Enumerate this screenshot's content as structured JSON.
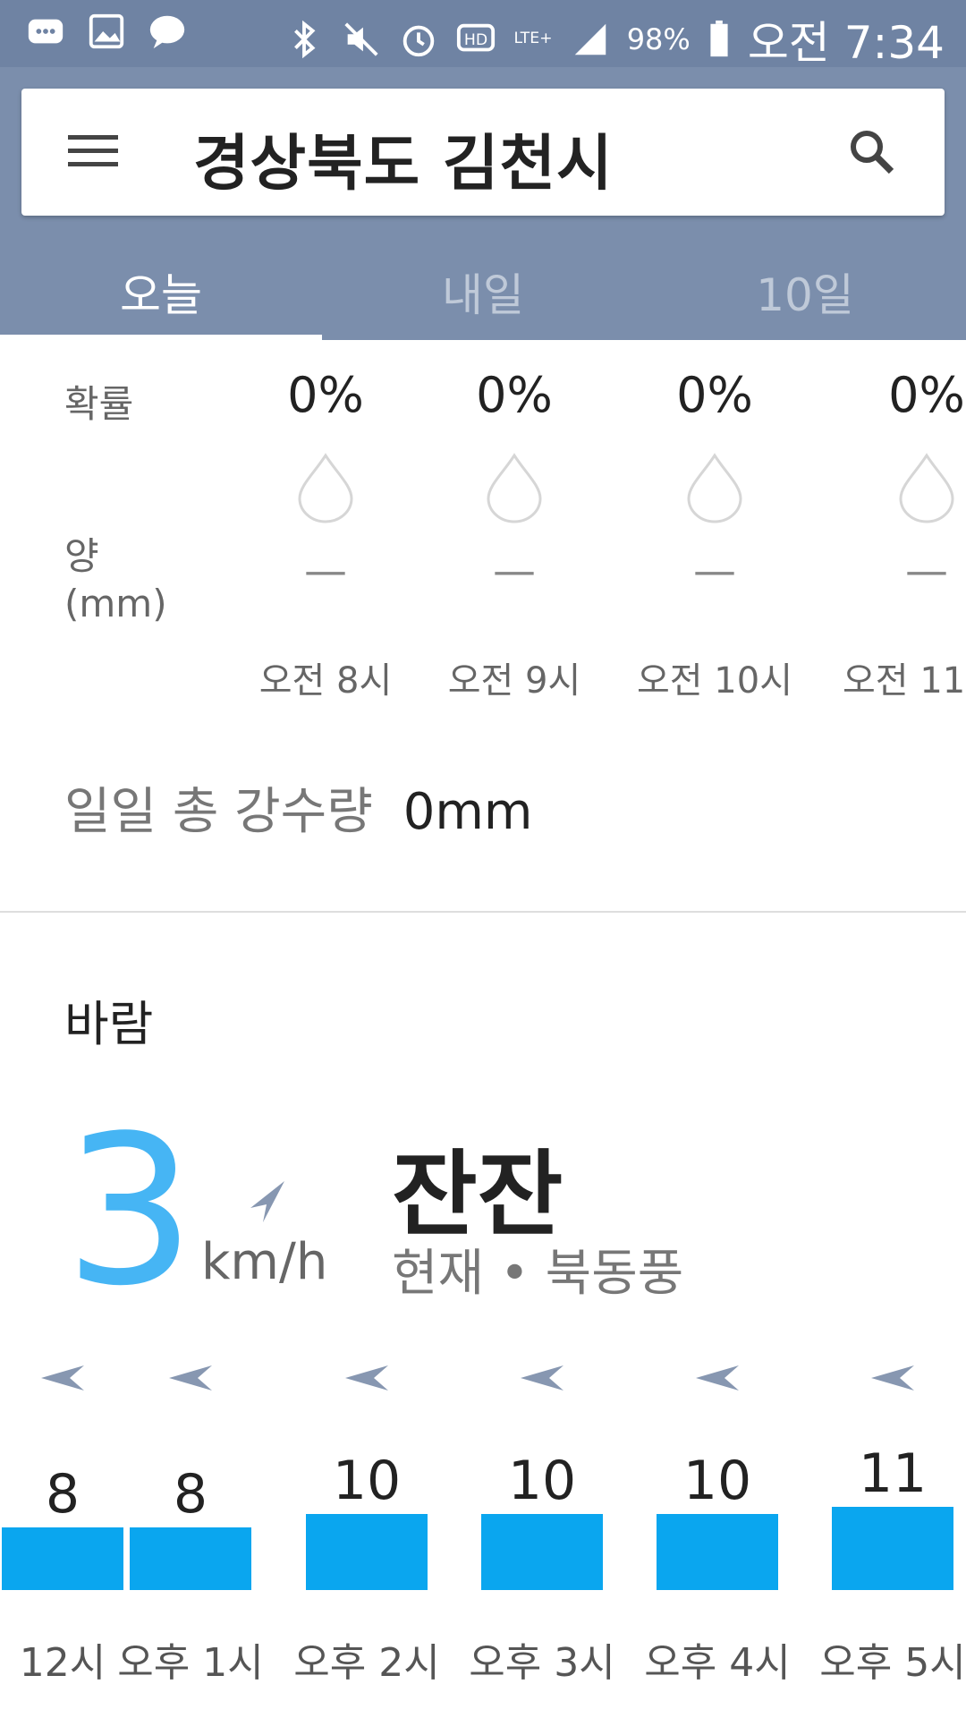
{
  "status_bar": {
    "battery": "98%",
    "time": "오전 7:34",
    "network": "LTE+"
  },
  "header": {
    "location": "경상북도 김천시",
    "tabs": [
      "오늘",
      "내일",
      "10일"
    ],
    "active_tab": 0
  },
  "precipitation": {
    "prob_label": "확률",
    "amount_label_line1": "양",
    "amount_label_line2": "(mm)",
    "hours": [
      {
        "time": "오전 8시",
        "prob": "0%",
        "amount": "—"
      },
      {
        "time": "오전 9시",
        "prob": "0%",
        "amount": "—"
      },
      {
        "time": "오전 10시",
        "prob": "0%",
        "amount": "—"
      },
      {
        "time": "오전 11",
        "prob": "0%",
        "amount": "—"
      }
    ],
    "daily_total_label": "일일 총 강수량",
    "daily_total_value": "0mm"
  },
  "wind": {
    "title": "바람",
    "speed": "3",
    "unit": "km/h",
    "description": "잔잔",
    "current_direction": "현재 • 북동풍",
    "hourly": [
      {
        "label": "12시",
        "value": "8"
      },
      {
        "label": "오후 1시",
        "value": "8"
      },
      {
        "label": "오후 2시",
        "value": "10"
      },
      {
        "label": "오후 3시",
        "value": "10"
      },
      {
        "label": "오후 4시",
        "value": "10"
      },
      {
        "label": "오후 5시",
        "value": "11"
      }
    ]
  },
  "colors": {
    "header_bg": "#7b8eac",
    "statusbar_bg": "#6f83a3",
    "accent_blue": "#46b5f4",
    "bar_blue": "#0aa6ef"
  }
}
